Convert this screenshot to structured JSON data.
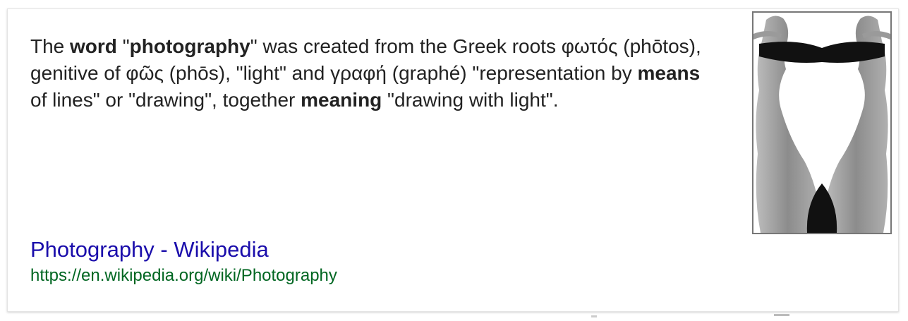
{
  "snippet": {
    "part1": "The ",
    "bold1": "word",
    "part2": " \"",
    "bold2": "photography",
    "part3": "\" was created from the Greek roots φωτός (phōtos), genitive of φῶς (phōs), \"light\" and γραφή (graphé) \"representation by ",
    "bold3": "means",
    "part4": " of lines\" or \"drawing\", together ",
    "bold4": "meaning",
    "part5": " \"drawing with light\"."
  },
  "result": {
    "title": "Photography - Wikipedia",
    "url": "https://en.wikipedia.org/wiki/Photography"
  },
  "colors": {
    "link": "#1a0dab",
    "url": "#006621",
    "text": "#222222"
  }
}
